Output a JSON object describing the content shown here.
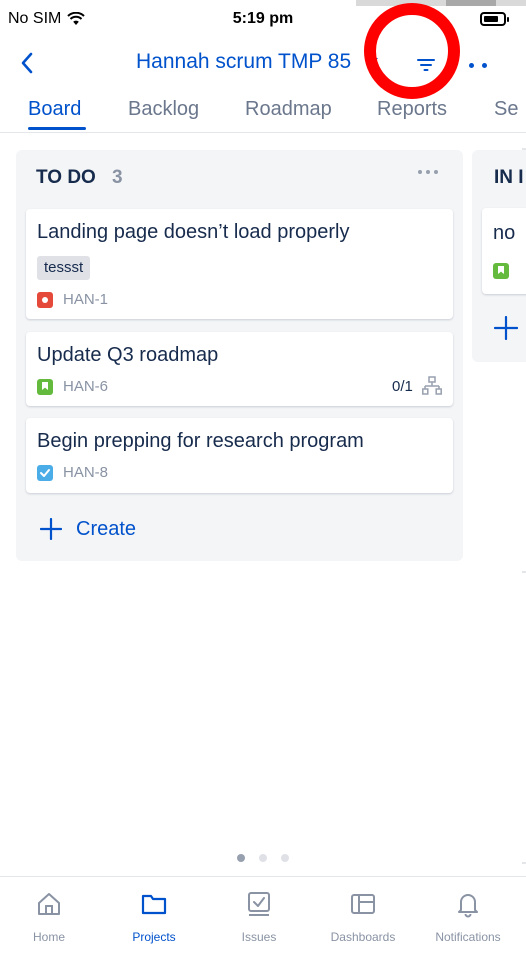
{
  "status_bar": {
    "carrier": "No SIM",
    "time": "5:19 pm"
  },
  "header": {
    "title": "Hannah scrum TMP 85"
  },
  "tabs": [
    {
      "label": "Board"
    },
    {
      "label": "Backlog"
    },
    {
      "label": "Roadmap"
    },
    {
      "label": "Reports"
    },
    {
      "label": "Se"
    }
  ],
  "board": {
    "columns": [
      {
        "name": "TO DO",
        "count": "3",
        "cards": [
          {
            "title": "Landing page doesn’t load properly",
            "label": "tessst",
            "type": "bug-icon",
            "key": "HAN-1"
          },
          {
            "title": "Update Q3 roadmap",
            "type": "story-icon",
            "key": "HAN-6",
            "subtasks": "0/1"
          },
          {
            "title": "Begin prepping for research program",
            "type": "task-icon",
            "key": "HAN-8"
          }
        ],
        "create_label": "Create"
      },
      {
        "name": "IN I",
        "cards": [
          {
            "title": "no",
            "type": "story-icon"
          }
        ]
      }
    ]
  },
  "bottom_nav": [
    {
      "label": "Home",
      "icon": "home-icon"
    },
    {
      "label": "Projects",
      "icon": "folder-icon"
    },
    {
      "label": "Issues",
      "icon": "issues-icon"
    },
    {
      "label": "Dashboards",
      "icon": "dashboards-icon"
    },
    {
      "label": "Notifications",
      "icon": "bell-icon"
    }
  ],
  "colors": {
    "accent": "#0052cc",
    "highlight": "#ff0000",
    "bug": "#e5493a",
    "story": "#63ba3c",
    "task": "#4bade8"
  }
}
